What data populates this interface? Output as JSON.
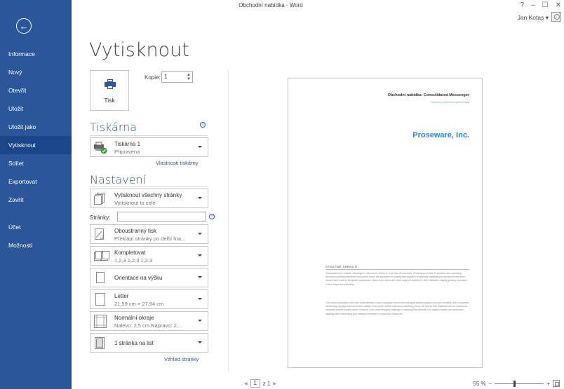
{
  "window": {
    "title": "Obchodní nabídka - Word",
    "controls": [
      "?",
      "–",
      "☐",
      "✕"
    ],
    "user": "Jan Kotas ▾"
  },
  "sidebar": {
    "items": [
      {
        "label": "Informace"
      },
      {
        "label": "Nový"
      },
      {
        "label": "Otevřít"
      },
      {
        "label": "Uložit"
      },
      {
        "label": "Uložit jako"
      },
      {
        "label": "Vytisknout"
      },
      {
        "label": "Sdílet"
      },
      {
        "label": "Exportovat"
      },
      {
        "label": "Zavřít"
      },
      {
        "label": "Účet"
      },
      {
        "label": "Možnosti"
      }
    ]
  },
  "main": {
    "title": "Vytisknout",
    "print_button": "Tisk",
    "copies_label": "Kopie:",
    "copies_value": "1"
  },
  "printer": {
    "section": "Tiskárna",
    "name": "Tiskárna 1",
    "status": "Připravena",
    "properties_link": "Vlastnosti tiskárny"
  },
  "settings": {
    "section": "Nastavení",
    "pages_label": "Stránky:",
    "page_setup_link": "Vzhled stránky",
    "items": [
      {
        "main": "Vytisknout všechny stránky",
        "sub": "Vytisknout to celé"
      },
      {
        "main": "Oboustranný tisk",
        "sub": "Překlápí stránky po delší hra..."
      },
      {
        "main": "Kompletovat",
        "sub": "1,2,3   1,2,3   1,2,3"
      },
      {
        "main": "Orientace na výšku",
        "sub": ""
      },
      {
        "main": "Letter",
        "sub": "21,59 cm × 27,94 cm"
      },
      {
        "main": "Normální okraje",
        "sub": "Nalevo: 2,5 cm   Napravo: 2,..."
      },
      {
        "main": "1 stránka na list",
        "sub": ""
      }
    ]
  },
  "preview": {
    "heading": "Obchodní nabídka: Consolidated Messenger",
    "subheading": "Důvěrný dokument společnosti",
    "company": "Proseware, Inc.",
    "summary_title": "STRUČNÉ SHRNUTÍ",
    "paragraph1": "Headquartered in Seattle, Washington, with branch offices in more than 50 countries, Proseware provides IT solutions and consulting services to leading enterprises around the world. We specialize in working with suppliers of specialty materials and services to help them expand their reach in the global marketplace. Most of our clients are either segment leaders or—like Fabrikam—rapidly growing innovators in their respective industries.",
    "paragraph2": "Our market specialists have paid close attention to your company's recent technological breakthroughs in product durability. With consumers demanding ongoing improvements in quality, even as the market improves controlling pricing, we believe that Fabrikam has the potential to dominate several market niches. However, your current biggest challenge in reaching that potential is to rapidly expand your production capacity while maximizing your existing investment in production resources."
  },
  "footer": {
    "current_page": "1",
    "page_total": "z 1",
    "zoom": "55 %"
  }
}
